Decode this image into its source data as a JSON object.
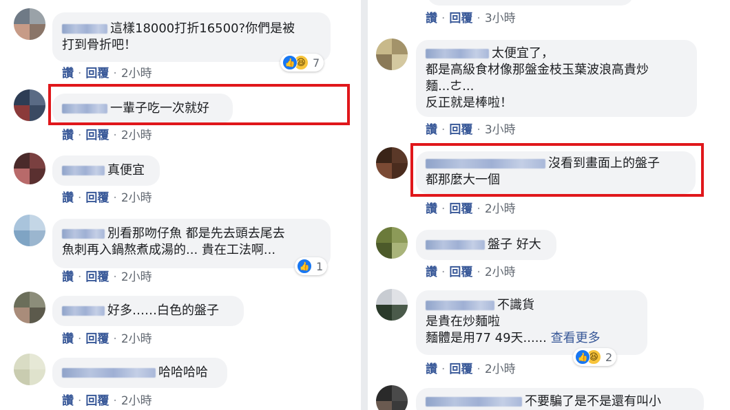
{
  "actions": {
    "like": "讚",
    "reply": "回覆",
    "separator": "·"
  },
  "left_comments": [
    {
      "text_line1": "這樣18000打折16500?你們是被",
      "text_line2": "打到骨折吧！",
      "time": "2小時",
      "reaction_count": "7"
    },
    {
      "text_line1": "一輩子吃一次就好",
      "time": "2小時"
    },
    {
      "text_line1": "真便宜",
      "time": "2小時"
    },
    {
      "text_line1": "別看那吻仔魚 都是先去頭去尾去",
      "text_line2": "魚刺再入鍋熬煮成湯的... 貴在工法啊...",
      "time": "2小時",
      "reaction_count": "1"
    },
    {
      "text_line1": "好多……白色的盤子",
      "time": "2小時"
    },
    {
      "text_line1": "哈哈哈哈",
      "time": "2小時"
    }
  ],
  "right_comments": [
    {
      "time": "3小時"
    },
    {
      "text_line1": "太便宜了，",
      "text_line2": "都是高級食材像那盤金枝玉葉波浪高貴炒",
      "text_line3": "麵...ㄜ...",
      "text_line4": "反正就是棒啦！",
      "time": "3小時"
    },
    {
      "text_line1": "沒看到畫面上的盤子",
      "text_line2": "都那麼大一個",
      "time": "2小時"
    },
    {
      "text_line1": "盤子 好大",
      "time": "2小時"
    },
    {
      "text_line1": "不識貨",
      "text_line2": "是貴在炒麵啦",
      "text_line3": "麵體是用77 49天......",
      "see_more": "查看更多",
      "time": "2小時",
      "reaction_count": "2"
    },
    {
      "text_line1": "不要騙了是不是還有叫小"
    }
  ],
  "colors": {
    "highlight": "#e0171b",
    "link": "#385898",
    "bubble": "#f2f3f5",
    "like": "#1877f2"
  }
}
